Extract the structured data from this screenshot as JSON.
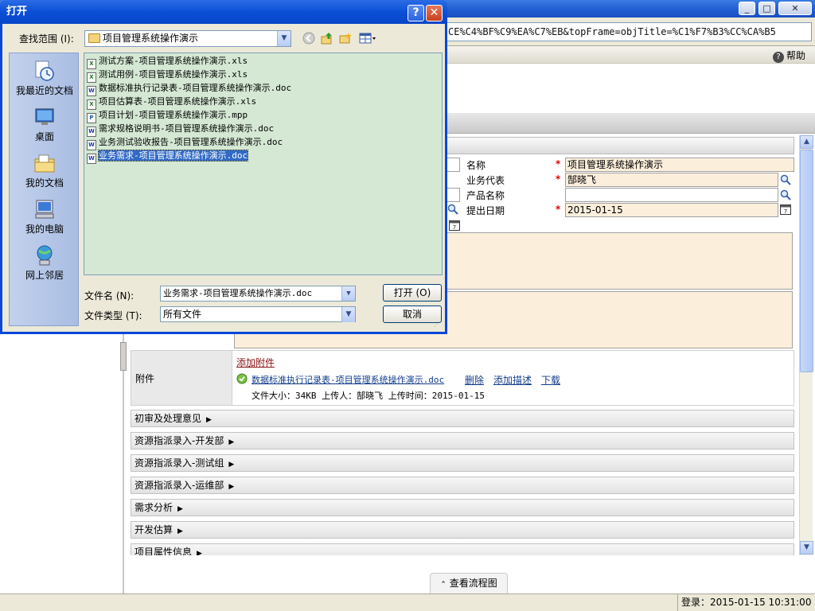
{
  "browser": {
    "address": "CE%C4%BF%C9%EA%C7%EB&topFrame=objTitle=%C1%F7%B3%CC%CA%B5",
    "help_label": "帮助",
    "status": "登录：2015-01-15 10:31:00",
    "flow_button": "查看流程图"
  },
  "form": {
    "fields": [
      {
        "label": "名称",
        "value": "项目管理系统操作演示"
      },
      {
        "label": "业务代表",
        "value": "郜晓飞"
      },
      {
        "label": "产品名称",
        "value": ""
      },
      {
        "label": "提出日期",
        "value": "2015-01-15"
      }
    ],
    "attachment": {
      "label": "附件",
      "add_link": "添加附件",
      "file_name": "数据标准执行记录表-项目管理系统操作演示.doc",
      "delete": "删除",
      "add_desc": "添加描述",
      "download": "下载",
      "meta": "文件大小：34KB 上传人：郜晓飞 上传时间：2015-01-15"
    },
    "sections": [
      "初审及处理意见",
      "资源指派录入-开发部",
      "资源指派录入-测试组",
      "资源指派录入-运维部",
      "需求分析",
      "开发估算",
      "项目属性信息"
    ]
  },
  "dialog": {
    "title": "打开",
    "look_in_label": "查找范围 (I):",
    "look_in_value": "项目管理系统操作演示",
    "places": [
      "我最近的文档",
      "桌面",
      "我的文档",
      "我的电脑",
      "网上邻居"
    ],
    "files": [
      {
        "name": "测试方案-项目管理系统操作演示.xls",
        "type": "xls"
      },
      {
        "name": "测试用例-项目管理系统操作演示.xls",
        "type": "xls"
      },
      {
        "name": "数据标准执行记录表-项目管理系统操作演示.doc",
        "type": "doc"
      },
      {
        "name": "项目估算表-项目管理系统操作演示.xls",
        "type": "xls"
      },
      {
        "name": "项目计划-项目管理系统操作演示.mpp",
        "type": "mpp"
      },
      {
        "name": "需求规格说明书-项目管理系统操作演示.doc",
        "type": "doc"
      },
      {
        "name": "业务测试验收报告-项目管理系统操作演示.doc",
        "type": "doc"
      },
      {
        "name": "业务需求-项目管理系统操作演示.doc",
        "type": "doc",
        "selected": true
      }
    ],
    "file_name_label": "文件名 (N):",
    "file_name_value": "业务需求-项目管理系统操作演示.doc",
    "file_type_label": "文件类型 (T):",
    "file_type_value": "所有文件",
    "open_button": "打开 (O)",
    "cancel_button": "取消"
  }
}
